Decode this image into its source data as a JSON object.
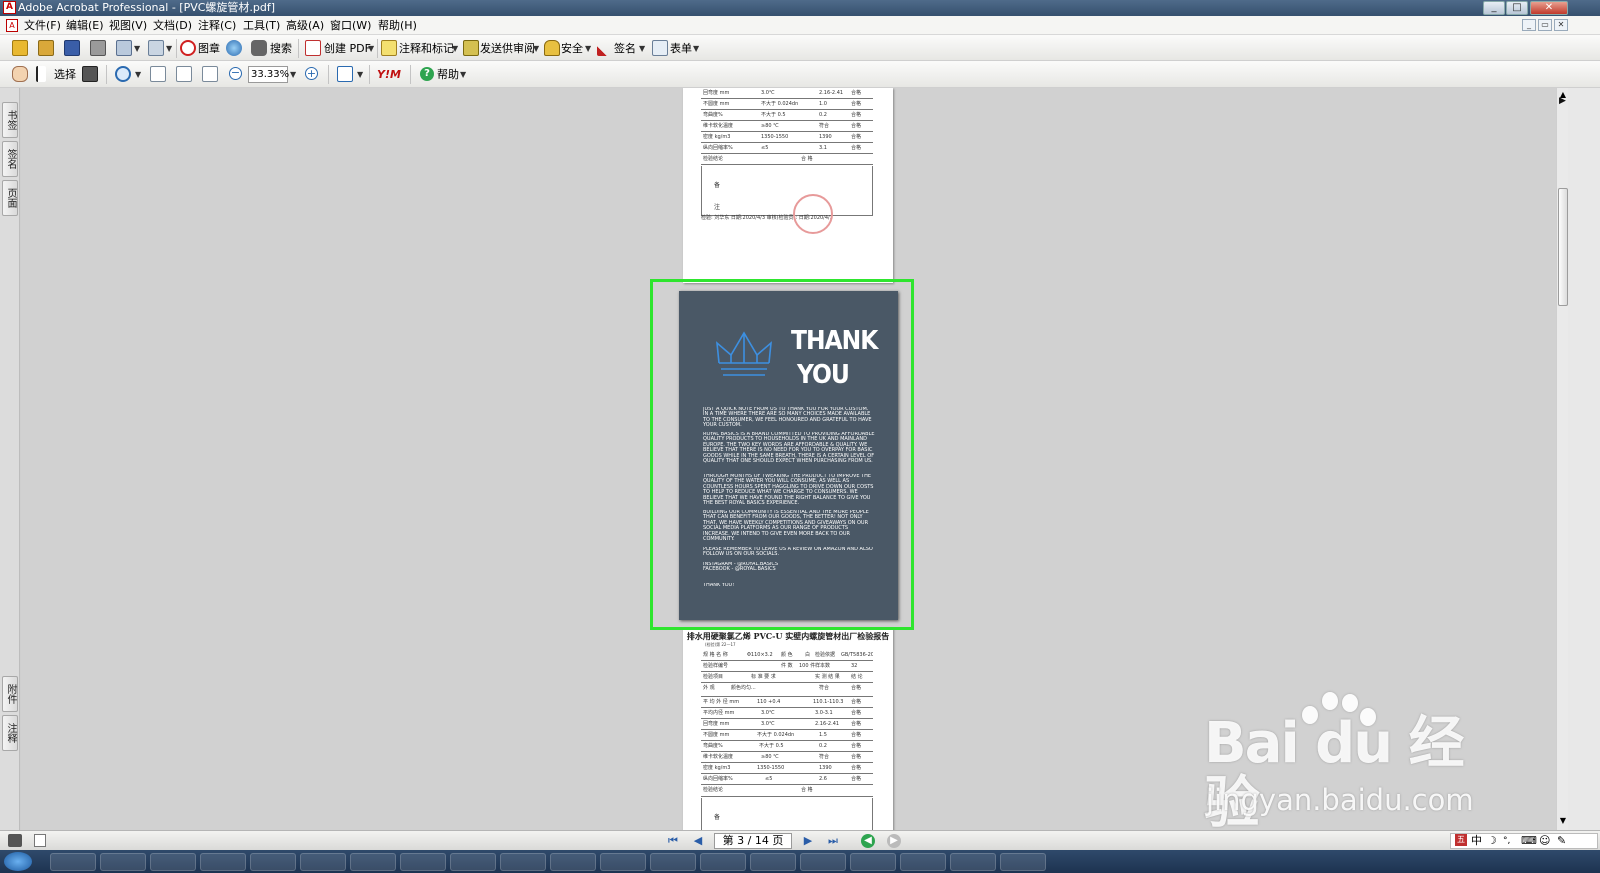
{
  "window": {
    "title": "Adobe Acrobat Professional - [PVC螺旋管材.pdf]",
    "app_icon_text": "A"
  },
  "menubar": {
    "items": [
      "文件(F)",
      "编辑(E)",
      "视图(V)",
      "文档(D)",
      "注释(C)",
      "工具(T)",
      "高级(A)",
      "窗口(W)",
      "帮助(H)"
    ]
  },
  "toolbar1": {
    "stamp_label": "图章",
    "search_label": "搜索",
    "create_pdf_label": "创建 PDF",
    "comment_label": "注释和标记",
    "send_review_label": "发送供审阅",
    "security_label": "安全",
    "sign_label": "签名",
    "forms_label": "表单"
  },
  "toolbar2": {
    "select_label": "选择",
    "zoom_value": "33.33%",
    "brand_label": "Y!M",
    "help_label": "帮助"
  },
  "left_panel": {
    "tabs": [
      "书签",
      "签名",
      "页面",
      "附件",
      "注释"
    ]
  },
  "document": {
    "prev_page": {
      "rows": [
        {
          "c1": "回弯度 mm",
          "c2": "3.0℃",
          "c3": "2.16-2.41",
          "c4": "合格"
        },
        {
          "c1": "不圆度 mm",
          "c2": "不大于 0.024dn",
          "c3": "1.0",
          "c4": "合格"
        },
        {
          "c1": "弯曲度%",
          "c2": "不大于 0.5",
          "c3": "0.2",
          "c4": "合格"
        },
        {
          "c1": "维卡软化温度",
          "c2": "≥80 ℃",
          "c3": "符合",
          "c4": "合格"
        },
        {
          "c1": "密度 kg/m3",
          "c2": "1350-1550",
          "c3": "1390",
          "c4": "合格"
        },
        {
          "c1": "纵向回缩率%",
          "c2": "≤5",
          "c3": "3.1",
          "c4": "合格"
        },
        {
          "c1": "检验结论",
          "c2": "合 格",
          "c3": "",
          "c4": ""
        }
      ],
      "remark_labels": [
        "备",
        "注"
      ],
      "footer": "检验: 刘华东    日期:2020/4/3    审核(检验员):    日期:2020/4/3"
    },
    "thank_page": {
      "title_line1": "THANK",
      "title_line2": "YOU",
      "paragraphs": [
        "JUST A QUICK NOTE FROM US TO THANK YOU FOR YOUR CUSTOM. IN A TIME WHERE THERE ARE SO MANY CHOICES MADE AVAILABLE TO THE CONSUMER, WE FEEL HONOURED AND GRATEFUL TO HAVE YOUR CUSTOM.",
        "ROYAL BASICS IS A BRAND COMMITTED TO PROVIDING AFFORDABLE QUALITY PRODUCTS TO HOUSEHOLDS IN THE UK AND MAINLAND EUROPE. THE TWO KEY WORDS ARE AFFORDABLE & QUALITY. WE BELIEVE THAT THERE IS NO NEED FOR YOU TO OVERPAY FOR BASIC GOODS WHILE IN THE SAME BREATH, THERE IS A CERTAIN LEVEL OF QUALITY THAT ONE SHOULD EXPECT WHEN PURCHASING FROM US.",
        "THROUGH MONTHS OF TWEAKING THE PRODUCT TO IMPROVE THE QUALITY OF THE WATER YOU WILL CONSUME, AS WELL AS COUNTLESS HOURS SPENT HAGGLING TO DRIVE DOWN OUR COSTS TO HELP TO REDUCE WHAT WE CHARGE TO CONSUMERS. WE BELIEVE THAT WE HAVE FOUND THE RIGHT BALANCE TO GIVE YOU THE BEST ROYAL BASICS EXPERIENCE.",
        "BUILDING OUR COMMUNITY IS ESSENTIAL AND THE MORE PEOPLE THAT CAN BENEFIT FROM OUR GOODS, THE BETTER! NOT ONLY THAT, WE HAVE WEEKLY COMPETITIONS AND GIVEAWAYS ON OUR SOCIAL MEDIA PLATFORMS AS OUR RANGE OF PRODUCTS INCREASE. WE INTEND TO GIVE EVEN MORE BACK TO OUR COMMUNITY.",
        "PLEASE REMEMBER TO LEAVE US A REVIEW ON AMAZON AND ALSO FOLLOW US ON OUR SOCIALS.",
        "INSTAGRAM - @ROYAL.BASICS\nFACEBOOK - @ROYAL.BASICS",
        "THANK YOU!"
      ]
    },
    "next_page": {
      "title": "排水用硬聚氯乙烯 PVC-U 实壁内螺旋管材出厂检验报告",
      "subtitle": "(检验)第 22—17",
      "rows": [
        {
          "c1": "规 格 名 称",
          "c2": "Φ110×3.2",
          "c3": "颜 色",
          "c4": "白",
          "c5": "检验依据",
          "c6": "GB/T5836-2017"
        },
        {
          "c1": "检验样编号",
          "c2": "",
          "c3": "件 数",
          "c4": "100 件",
          "c5": "样本数",
          "c6": "32"
        },
        {
          "c1": "检验项目",
          "c2": "标 准 要 求",
          "c3": "",
          "c4": "",
          "c5": "实 测 结 果",
          "c6": "结 论"
        },
        {
          "c1": "外 观",
          "c2": "颜色均匀...",
          "c3": "",
          "c4": "",
          "c5": "符合",
          "c6": "合格"
        },
        {
          "c1": "平 均 外 径 mm",
          "c2": "110 +0.4",
          "c3": "",
          "c4": "",
          "c5": "110.1-110.3",
          "c6": "合格"
        },
        {
          "c1": "平均内径 mm",
          "c2": "3.0℃",
          "c3": "",
          "c4": "",
          "c5": "3.0-3.1",
          "c6": "合格"
        },
        {
          "c1": "回弯度 mm",
          "c2": "3.0℃",
          "c3": "",
          "c4": "",
          "c5": "2.16-2.41",
          "c6": "合格"
        },
        {
          "c1": "不圆度 mm",
          "c2": "不大于 0.024dn",
          "c3": "",
          "c4": "",
          "c5": "1.5",
          "c6": "合格"
        },
        {
          "c1": "弯曲度%",
          "c2": "不大于 0.5",
          "c3": "",
          "c4": "",
          "c5": "0.2",
          "c6": "合格"
        },
        {
          "c1": "维卡软化温度",
          "c2": "≥80 ℃",
          "c3": "",
          "c4": "",
          "c5": "符合",
          "c6": "合格"
        },
        {
          "c1": "密度 kg/m3",
          "c2": "1350-1550",
          "c3": "",
          "c4": "",
          "c5": "1390",
          "c6": "合格"
        },
        {
          "c1": "纵向回缩率%",
          "c2": "≤5",
          "c3": "",
          "c4": "",
          "c5": "2.6",
          "c6": "合格"
        },
        {
          "c1": "检验结论",
          "c2": "合 格",
          "c3": "",
          "c4": "",
          "c5": "",
          "c6": ""
        }
      ],
      "remark_label": "备"
    }
  },
  "statusbar": {
    "page_indicator": "第 3 / 14 页"
  },
  "ime": {
    "lang": "中"
  },
  "watermark": {
    "logo": "Bai du 经验",
    "url": "jingyan.baidu.com"
  },
  "colors": {
    "thank_page_bg": "#4a5866",
    "selection_border": "#2ee52e",
    "crown": "#3d8fe0"
  }
}
